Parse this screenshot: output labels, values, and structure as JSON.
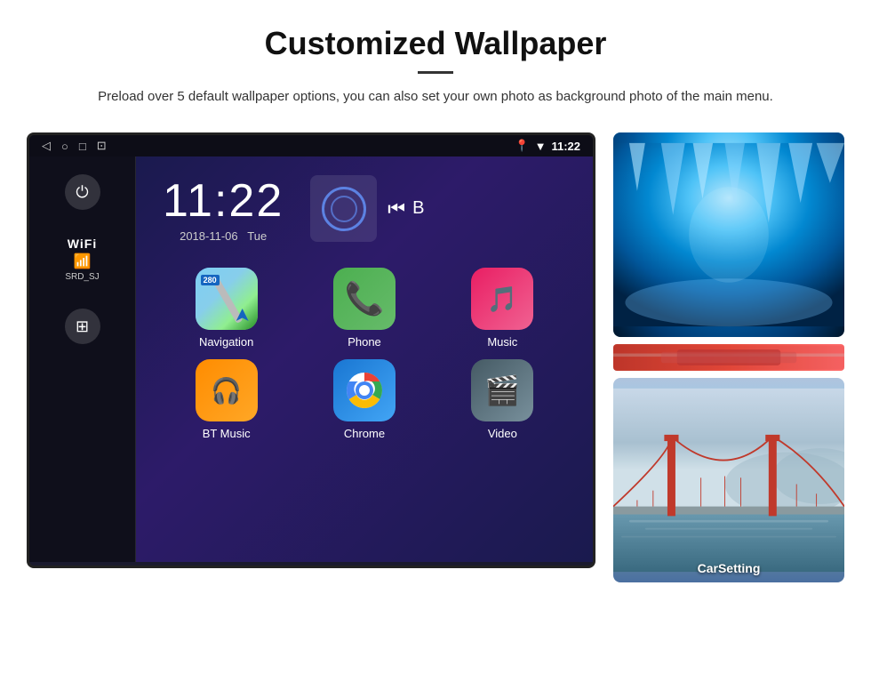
{
  "header": {
    "title": "Customized Wallpaper",
    "description": "Preload over 5 default wallpaper options, you can also set your own photo as background photo of the main menu."
  },
  "device": {
    "status_bar": {
      "nav_back": "◁",
      "nav_home": "○",
      "nav_recent": "□",
      "nav_screen": "⊡",
      "time": "11:22",
      "location_icon": "📍",
      "wifi_icon": "▼",
      "signal_bars": "▼"
    },
    "clock": {
      "time": "11:22",
      "date": "2018-11-06",
      "day": "Tue"
    },
    "wifi": {
      "label": "WiFi",
      "ssid": "SRD_SJ"
    },
    "apps": [
      {
        "id": "navigation",
        "label": "Navigation",
        "badge": "280"
      },
      {
        "id": "phone",
        "label": "Phone"
      },
      {
        "id": "music",
        "label": "Music"
      },
      {
        "id": "btmusic",
        "label": "BT Music"
      },
      {
        "id": "chrome",
        "label": "Chrome"
      },
      {
        "id": "video",
        "label": "Video"
      }
    ],
    "wallpaper_label": "CarSetting"
  },
  "icons": {
    "power": "⏻",
    "apps_grid": "⊞",
    "back": "◁",
    "home": "○",
    "recent": "□",
    "screenshot": "⊡",
    "skip_prev": "⏮",
    "bluetooth_label": "Ꞵ"
  }
}
